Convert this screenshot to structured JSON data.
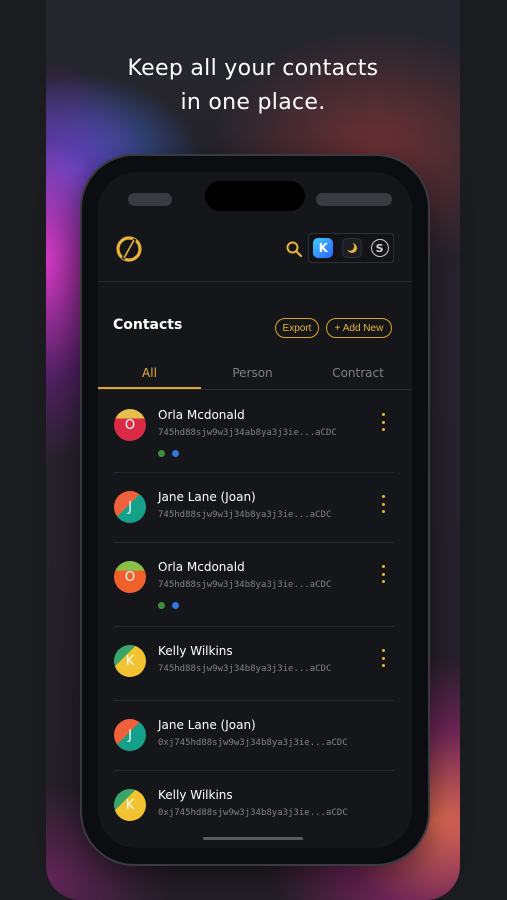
{
  "headline": {
    "line1": "Keep all your contacts",
    "line2": "in one place."
  },
  "header": {
    "logo_icon": "wallet-logo",
    "search_icon": "search-icon",
    "accounts": [
      {
        "icon": "k-account-icon",
        "label": "K"
      },
      {
        "icon": "sun-account-icon",
        "label": ""
      },
      {
        "icon": "s-account-icon",
        "label": "S"
      }
    ]
  },
  "contacts_header": {
    "title": "Contacts",
    "export_label": "Export",
    "add_label": "+ Add New"
  },
  "tabs": [
    {
      "label": "All",
      "active": true
    },
    {
      "label": "Person",
      "active": false
    },
    {
      "label": "Contract",
      "active": false
    }
  ],
  "contacts": [
    {
      "initial": "O",
      "name": "Orla Mcdonald",
      "address": "745hd88sjw9w3j34ab8ya3j3ie...aCDC",
      "tags": [
        "green",
        "blue"
      ],
      "menu": true
    },
    {
      "initial": "J",
      "name": "Jane Lane (Joan)",
      "address": "745hd88sjw9w3j34b8ya3j3ie...aCDC",
      "tags": [],
      "menu": true
    },
    {
      "initial": "O",
      "name": "Orla Mcdonald",
      "address": "745hd88sjw9w3j34b8ya3j3ie...aCDC",
      "tags": [
        "green",
        "blue"
      ],
      "menu": true
    },
    {
      "initial": "K",
      "name": "Kelly Wilkins",
      "address": "745hd88sjw9w3j34b8ya3j3ie...aCDC",
      "tags": [],
      "menu": true
    },
    {
      "initial": "J",
      "name": "Jane Lane (Joan)",
      "address": "0xj745hd88sjw9w3j34b8ya3j3ie...aCDC",
      "tags": [],
      "menu": false
    },
    {
      "initial": "K",
      "name": "Kelly Wilkins",
      "address": "0xj745hd88sjw9w3j34b8ya3j3ie...aCDC",
      "tags": [],
      "menu": false
    }
  ],
  "colors": {
    "accent": "#e9b43a",
    "background": "#15161a",
    "tag_green": "#3f8f3a",
    "tag_blue": "#3478e0"
  }
}
